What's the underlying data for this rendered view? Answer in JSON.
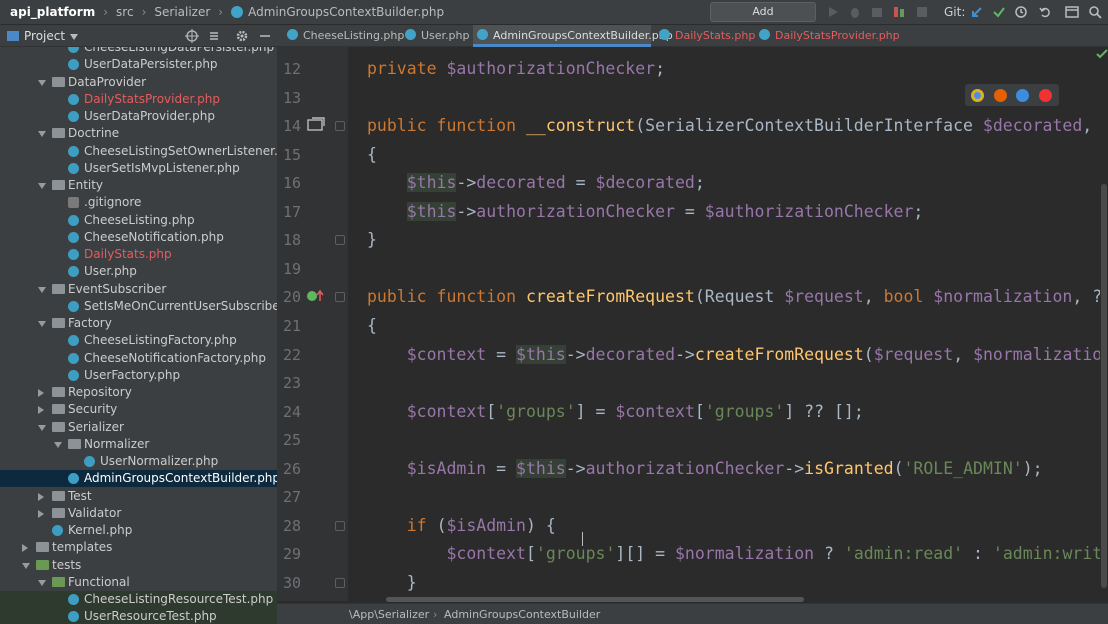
{
  "navbar": {
    "project": "api_platform",
    "path": [
      "src",
      "Serializer"
    ],
    "file": "AdminGroupsContextBuilder.php",
    "add_configuration": "Add Configuration...",
    "git_label": "Git:"
  },
  "project_panel": {
    "title": "Project",
    "tree": [
      {
        "label": "CheeseListingDataPersister.php",
        "depth": 3,
        "kind": "php",
        "partial": true
      },
      {
        "label": "UserDataPersister.php",
        "depth": 3,
        "kind": "php"
      },
      {
        "label": "DataProvider",
        "depth": 2,
        "kind": "folder",
        "open": true
      },
      {
        "label": "DailyStatsProvider.php",
        "depth": 3,
        "kind": "php",
        "status": "modified"
      },
      {
        "label": "UserDataProvider.php",
        "depth": 3,
        "kind": "php"
      },
      {
        "label": "Doctrine",
        "depth": 2,
        "kind": "folder",
        "open": true
      },
      {
        "label": "CheeseListingSetOwnerListener.php",
        "depth": 3,
        "kind": "php"
      },
      {
        "label": "UserSetIsMvpListener.php",
        "depth": 3,
        "kind": "php"
      },
      {
        "label": "Entity",
        "depth": 2,
        "kind": "folder",
        "open": true
      },
      {
        "label": ".gitignore",
        "depth": 3,
        "kind": "git"
      },
      {
        "label": "CheeseListing.php",
        "depth": 3,
        "kind": "php"
      },
      {
        "label": "CheeseNotification.php",
        "depth": 3,
        "kind": "php"
      },
      {
        "label": "DailyStats.php",
        "depth": 3,
        "kind": "php",
        "status": "modified"
      },
      {
        "label": "User.php",
        "depth": 3,
        "kind": "php"
      },
      {
        "label": "EventSubscriber",
        "depth": 2,
        "kind": "folder",
        "open": true
      },
      {
        "label": "SetIsMeOnCurrentUserSubscriber.php",
        "depth": 3,
        "kind": "php"
      },
      {
        "label": "Factory",
        "depth": 2,
        "kind": "folder",
        "open": true
      },
      {
        "label": "CheeseListingFactory.php",
        "depth": 3,
        "kind": "php"
      },
      {
        "label": "CheeseNotificationFactory.php",
        "depth": 3,
        "kind": "php"
      },
      {
        "label": "UserFactory.php",
        "depth": 3,
        "kind": "php"
      },
      {
        "label": "Repository",
        "depth": 2,
        "kind": "folder",
        "open": false
      },
      {
        "label": "Security",
        "depth": 2,
        "kind": "folder",
        "open": false
      },
      {
        "label": "Serializer",
        "depth": 2,
        "kind": "folder",
        "open": true
      },
      {
        "label": "Normalizer",
        "depth": 3,
        "kind": "folder",
        "open": true
      },
      {
        "label": "UserNormalizer.php",
        "depth": 4,
        "kind": "php"
      },
      {
        "label": "AdminGroupsContextBuilder.php",
        "depth": 3,
        "kind": "php",
        "selected": true
      },
      {
        "label": "Test",
        "depth": 2,
        "kind": "folder",
        "open": false
      },
      {
        "label": "Validator",
        "depth": 2,
        "kind": "folder",
        "open": false
      },
      {
        "label": "Kernel.php",
        "depth": 2,
        "kind": "php"
      },
      {
        "label": "templates",
        "depth": 1,
        "kind": "folder",
        "open": false
      },
      {
        "label": "tests",
        "depth": 1,
        "kind": "folder-tests",
        "open": true
      },
      {
        "label": "Functional",
        "depth": 2,
        "kind": "folder-tests",
        "open": true
      },
      {
        "label": "CheeseListingResourceTest.php",
        "depth": 3,
        "kind": "php",
        "green": true
      },
      {
        "label": "UserResourceTest.php",
        "depth": 3,
        "kind": "php",
        "green": true,
        "partial": true
      }
    ]
  },
  "tabs": [
    {
      "label": "CheeseListing.php"
    },
    {
      "label": "User.php"
    },
    {
      "label": "AdminGroupsContextBuilder.php",
      "active": true
    },
    {
      "label": "DailyStats.php",
      "status": "modified"
    },
    {
      "label": "DailyStatsProvider.php",
      "status": "modified"
    }
  ],
  "editor": {
    "lines": [
      {
        "n": "12",
        "tokens": [
          [
            "kw",
            "private "
          ],
          [
            "var",
            "$authorizationChecker"
          ],
          [
            "",
            "; "
          ]
        ]
      },
      {
        "n": "13",
        "tokens": []
      },
      {
        "n": "14",
        "tokens": [
          [
            "kw",
            "public function "
          ],
          [
            "fn",
            "__construct"
          ],
          [
            "",
            "(SerializerContextBuilderInterface "
          ],
          [
            "var",
            "$decorated"
          ],
          [
            "",
            ", Auth"
          ]
        ]
      },
      {
        "n": "15",
        "tokens": [
          [
            "",
            "{"
          ]
        ]
      },
      {
        "n": "16",
        "tokens": [
          [
            "",
            "    "
          ],
          [
            "var-this",
            "$this"
          ],
          [
            "",
            "->"
          ],
          [
            "var",
            "decorated"
          ],
          [
            "",
            " = "
          ],
          [
            "var",
            "$decorated"
          ],
          [
            "",
            ";"
          ]
        ]
      },
      {
        "n": "17",
        "tokens": [
          [
            "",
            "    "
          ],
          [
            "var-this",
            "$this"
          ],
          [
            "",
            "->"
          ],
          [
            "var",
            "authorizationChecker"
          ],
          [
            "",
            " = "
          ],
          [
            "var",
            "$authorizationChecker"
          ],
          [
            "",
            ";"
          ]
        ]
      },
      {
        "n": "18",
        "tokens": [
          [
            "",
            "}"
          ]
        ]
      },
      {
        "n": "19",
        "tokens": []
      },
      {
        "n": "20",
        "tokens": [
          [
            "kw",
            "public function "
          ],
          [
            "fn",
            "createFromRequest"
          ],
          [
            "",
            "(Request "
          ],
          [
            "var",
            "$request"
          ],
          [
            "",
            ", "
          ],
          [
            "kw",
            "bool "
          ],
          [
            "var",
            "$normalization"
          ],
          [
            "",
            ", ?"
          ],
          [
            "kw",
            "arra"
          ]
        ]
      },
      {
        "n": "21",
        "tokens": [
          [
            "",
            "{"
          ]
        ]
      },
      {
        "n": "22",
        "tokens": [
          [
            "",
            "    "
          ],
          [
            "var",
            "$context"
          ],
          [
            "",
            " = "
          ],
          [
            "var-this",
            "$this"
          ],
          [
            "",
            "->"
          ],
          [
            "var",
            "decorated"
          ],
          [
            "",
            "->"
          ],
          [
            "fn",
            "createFromRequest"
          ],
          [
            "",
            "("
          ],
          [
            "var",
            "$request"
          ],
          [
            "",
            ", "
          ],
          [
            "var",
            "$normalization"
          ],
          [
            "",
            ", "
          ],
          [
            "var",
            "$"
          ]
        ]
      },
      {
        "n": "23",
        "tokens": []
      },
      {
        "n": "24",
        "tokens": [
          [
            "",
            "    "
          ],
          [
            "var",
            "$context"
          ],
          [
            "",
            "["
          ],
          [
            "str",
            "'groups'"
          ],
          [
            "",
            "] = "
          ],
          [
            "var",
            "$context"
          ],
          [
            "",
            "["
          ],
          [
            "str",
            "'groups'"
          ],
          [
            "",
            "] ?? [];"
          ]
        ]
      },
      {
        "n": "25",
        "tokens": []
      },
      {
        "n": "26",
        "tokens": [
          [
            "",
            "    "
          ],
          [
            "var",
            "$isAdmin"
          ],
          [
            "",
            " = "
          ],
          [
            "var-this",
            "$this"
          ],
          [
            "",
            "->"
          ],
          [
            "var",
            "authorizationChecker"
          ],
          [
            "",
            "->"
          ],
          [
            "fn",
            "isGranted"
          ],
          [
            "",
            "("
          ],
          [
            "str",
            "'ROLE_ADMIN'"
          ],
          [
            "",
            ");"
          ]
        ]
      },
      {
        "n": "27",
        "tokens": []
      },
      {
        "n": "28",
        "tokens": [
          [
            "",
            "    "
          ],
          [
            "kw",
            "if "
          ],
          [
            "",
            "("
          ],
          [
            "var",
            "$isAdmin"
          ],
          [
            "",
            ") {"
          ]
        ]
      },
      {
        "n": "29",
        "tokens": [
          [
            "",
            "        "
          ],
          [
            "var",
            "$context"
          ],
          [
            "",
            "["
          ],
          [
            "str",
            "'groups'"
          ],
          [
            "",
            "][] = "
          ],
          [
            "var",
            "$normalization"
          ],
          [
            "",
            " ? "
          ],
          [
            "str",
            "'admin:read'"
          ],
          [
            "",
            " : "
          ],
          [
            "str",
            "'admin:write'"
          ],
          [
            "",
            ";"
          ]
        ]
      },
      {
        "n": "30",
        "tokens": [
          [
            "",
            "    }"
          ]
        ]
      }
    ]
  },
  "status_breadcrumb": [
    "\\App\\Serializer",
    "AdminGroupsContextBuilder"
  ],
  "colors": {
    "keyword": "#cc7832",
    "variable": "#9876aa",
    "function": "#ffc66d",
    "string": "#6a8759",
    "modified_file": "#e55c5c",
    "selection": "#0d293e"
  }
}
